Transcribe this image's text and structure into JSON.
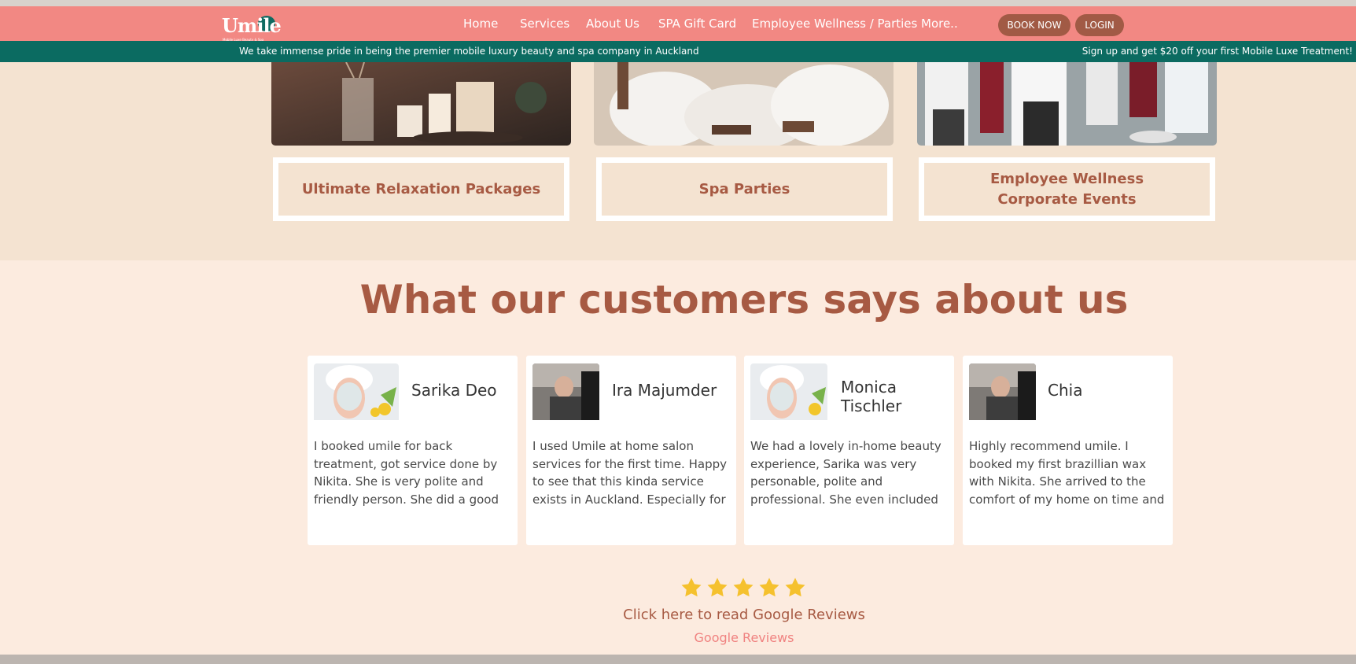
{
  "header": {
    "logo_text": "Umile",
    "logo_sub": "Mobile Luxe Beauty & Spa",
    "nav": [
      "Home",
      "Services",
      "About Us",
      "SPA Gift Card",
      "Employee Wellness / Parties",
      "More.."
    ],
    "book_now": "BOOK NOW",
    "login": "LOGIN"
  },
  "promo": {
    "left": "We take immense pride in being the premier mobile luxury beauty and spa company in Auckland",
    "right": "Sign up and get $20 off your first Mobile Luxe Treatment!"
  },
  "services": [
    {
      "title": "Ultimate Relaxation Packages"
    },
    {
      "title": "Spa Parties"
    },
    {
      "title_line1": "Employee Wellness",
      "title_line2": "Corporate Events"
    }
  ],
  "testimonials": {
    "heading": "What our customers says about us",
    "cards": [
      {
        "name": "Sarika Deo",
        "text": "I booked umile for back treatment, got service done by Nikita. She is very polite and friendly person. She did a good job really happy with h..."
      },
      {
        "name": "Ira Majumder",
        "text": "I used Umile at home salon services for the first time. Happy to see that this kinda service exists in Auckland. Especially for mothers it..."
      },
      {
        "name_line1": "Monica",
        "name_line2": "Tischler",
        "text": "We had a lovely in-home beauty experience, Sarika was very personable, polite and professional. She even included complimentary..."
      },
      {
        "name": "Chia",
        "text": "Highly recommend umile. I booked my first brazillian wax with Nikita. She arrived to the comfort of my home on time and she was very..."
      }
    ]
  },
  "reviews": {
    "rating_stars": 5,
    "link_text": "Click here to read Google Reviews",
    "sub_link": "Google Reviews"
  },
  "colors": {
    "nav_bg": "#f28883",
    "promo_bg": "#0b6b61",
    "accent": "#a75a43",
    "star": "#f5c12e"
  }
}
